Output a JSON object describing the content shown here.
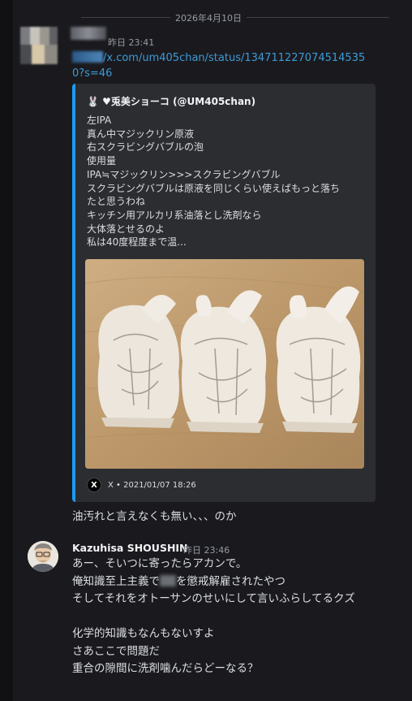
{
  "date_divider": "2026年4月10日",
  "message1": {
    "timestamp": "昨日 23:41",
    "link_text": "/x.com/um405chan/status/1347112270745145350?s=46",
    "embed": {
      "author_emoji": "🐰",
      "author": "♥兎美ショーコ (@UM405chan)",
      "description_lines": [
        "左IPA",
        "真ん中マジックリン原液",
        "右スクラビングバブルの泡",
        "使用量",
        "IPA≒マジックリン>>>スクラビングバブル",
        "スクラビングバブルは原液を同じくらい使えばもっと落ち",
        "たと思うわね",
        "キッチン用アルカリ系油落とし洗剤なら",
        "大体落とせるのよ",
        "私は40度程度まで温..."
      ],
      "footer_icon": "x-logo-icon",
      "footer_text": "X • 2021/01/07 18:26"
    },
    "text": "油汚れと言えなくも無い、、、のか"
  },
  "message2": {
    "author": "Kazuhisa SHOUSHIN",
    "timestamp": "昨日 23:46",
    "lines": [
      "あー、そいつに寄ったらアカンで。",
      "そしてそれをオトーサンのせいにして言いふらしてるクズ",
      "",
      "化学的知識もなんもないすよ",
      "さあここで問題だ",
      "重合の隙間に洗剤噛んだらどーなる？"
    ],
    "line2_before": "俺知識至上主義で",
    "line2_after": "を懲戒解雇されたやつ"
  },
  "colors": {
    "background": "#1a1a1e",
    "embed_bg": "#2b2d31",
    "embed_accent": "#1d9bf0",
    "link": "#3d9ad6",
    "muted": "#949ba4"
  }
}
